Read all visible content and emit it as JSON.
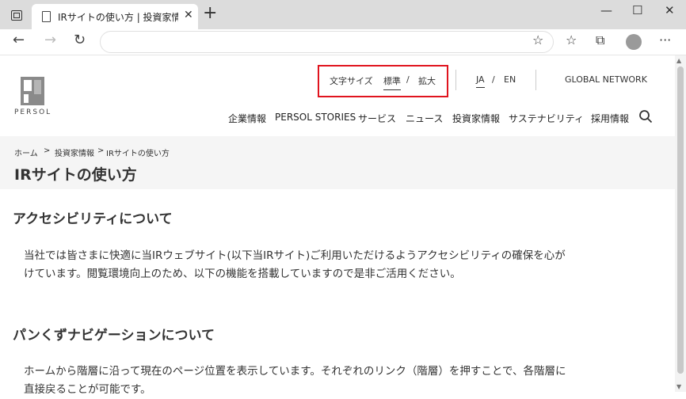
{
  "browser": {
    "tab_title": "IRサイトの使い方 | 投資家情報 | PE",
    "newtab_glyph": "+",
    "tab_close_glyph": "✕",
    "window_buttons": [
      "—",
      "☐",
      "✕"
    ],
    "nav": {
      "back": "←",
      "forward": "→",
      "reload": "↻"
    },
    "tools": {
      "favorite": "☆",
      "favorites": "☆",
      "collections": "⧉",
      "more": "···"
    }
  },
  "site": {
    "logo_text": "PERSOL",
    "utility": {
      "font_size_label": "文字サイズ",
      "font_standard": "標準",
      "font_sep": "/",
      "font_large": "拡大",
      "lang_ja": "JA",
      "lang_sep": "/",
      "lang_en": "EN",
      "global_network": "GLOBAL NETWORK"
    },
    "main_nav": [
      "企業情報",
      "PERSOL STORIES",
      "サービス",
      "ニュース",
      "投資家情報",
      "サステナビリティ",
      "採用情報"
    ],
    "breadcrumb": [
      "ホーム",
      "投資家情報",
      "IRサイトの使い方"
    ],
    "breadcrumb_sep": ">",
    "page_title": "IRサイトの使い方",
    "sections": [
      {
        "heading": "アクセシビリティについて",
        "lines": [
          "当社では皆さまに快適に当IRウェブサイト(以下当IRサイト)ご利用いただけるようアクセシビリティの確保を心が",
          "けています。閲覧環境向上のため、以下の機能を搭載していますので是非ご活用ください。"
        ]
      },
      {
        "heading": "パンくずナビゲーションについて",
        "lines": [
          "ホームから階層に沿って現在のページ位置を表示しています。それぞれのリンク（階層）を押すことで、各階層に",
          "直接戻ることが可能です。"
        ]
      }
    ]
  },
  "colors": {
    "highlight": "#e0141e",
    "logo": "#8a8a8a"
  }
}
